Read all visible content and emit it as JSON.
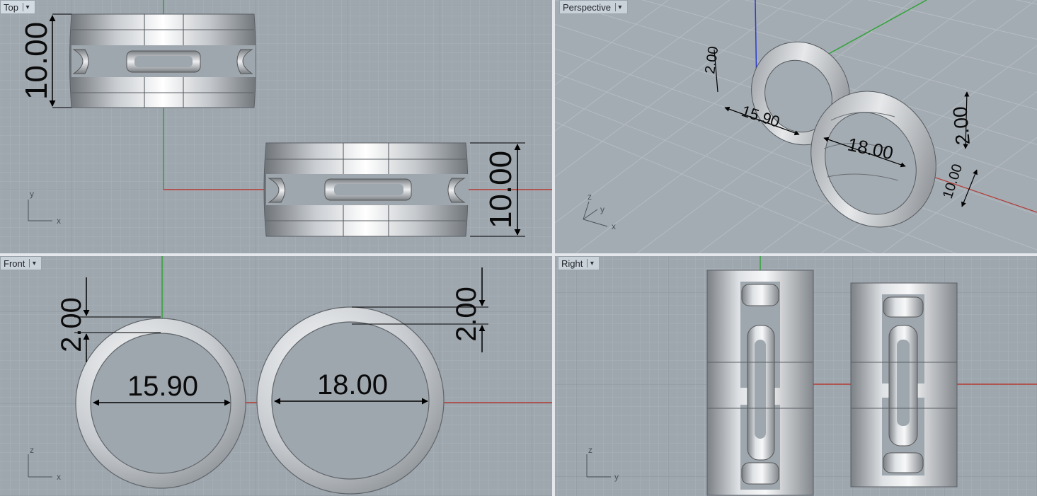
{
  "viewports": {
    "top": {
      "label": "Top",
      "dims": [
        "10.00",
        "10.00"
      ],
      "axes": [
        "y",
        "x"
      ]
    },
    "perspective": {
      "label": "Perspective",
      "dims": [
        "2.00",
        "15.90",
        "18.00",
        "2.00",
        "10.00"
      ],
      "axes": [
        "z",
        "y",
        "x"
      ]
    },
    "front": {
      "label": "Front",
      "dims": [
        "2.00",
        "15.90",
        "18.00",
        "2.00"
      ],
      "axes": [
        "z",
        "x"
      ]
    },
    "right": {
      "label": "Right",
      "axes": [
        "z",
        "y"
      ]
    }
  },
  "colors": {
    "viewport_bg": "#9ea6ae",
    "grid_minor": "#a9b1b8",
    "grid_major": "#8e979f",
    "x_axis": "#b43a34",
    "y_axis": "#2fa336",
    "z_axis": "#2a3bd0",
    "tab_bg": "#c9d1d9"
  }
}
